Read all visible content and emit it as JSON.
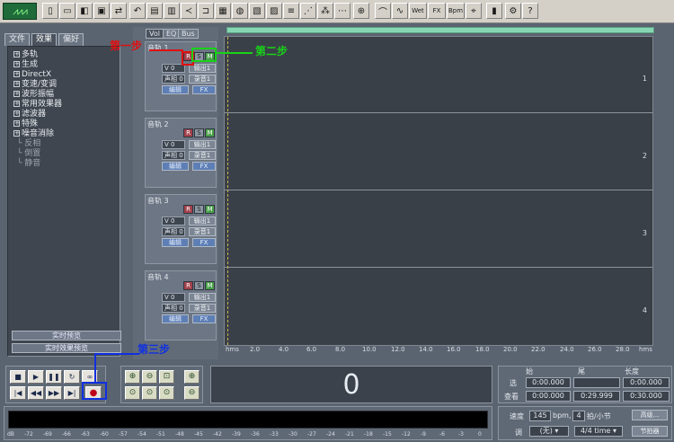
{
  "colors": {
    "step1": "#e01010",
    "step2": "#19d219",
    "step3": "#1030e0"
  },
  "left_panel": {
    "tabs": [
      "文件",
      "效果",
      "偏好"
    ],
    "tree": [
      {
        "label": "多轨",
        "expandable": true
      },
      {
        "label": "生成",
        "expandable": true
      },
      {
        "label": "DirectX",
        "expandable": true
      },
      {
        "label": "变速/变调",
        "expandable": true
      },
      {
        "label": "波形振幅",
        "expandable": true
      },
      {
        "label": "常用效果器",
        "expandable": true
      },
      {
        "label": "滤波器",
        "expandable": true
      },
      {
        "label": "特殊",
        "expandable": true
      },
      {
        "label": "噪音消除",
        "expandable": true
      },
      {
        "label": "反相",
        "expandable": false
      },
      {
        "label": "倒置",
        "expandable": false
      },
      {
        "label": "静音",
        "expandable": false
      }
    ],
    "btn_realtime": "实时预览",
    "btn_effects": "实时效果预览"
  },
  "track_tabs": [
    "Vol",
    "EQ",
    "Bus"
  ],
  "tracks": [
    {
      "name": "音轨 1",
      "vol": "V 0",
      "pan": "声相 0",
      "out": "输出1",
      "in": "录音1",
      "edit": "编辑",
      "fx": "FX",
      "lane": "1"
    },
    {
      "name": "音轨 2",
      "vol": "V 0",
      "pan": "声相 0",
      "out": "输出1",
      "in": "录音1",
      "edit": "编辑",
      "fx": "FX",
      "lane": "2"
    },
    {
      "name": "音轨 3",
      "vol": "V 0",
      "pan": "声相 0",
      "out": "输出1",
      "in": "录音1",
      "edit": "编辑",
      "fx": "FX",
      "lane": "3"
    },
    {
      "name": "音轨 4",
      "vol": "V 0",
      "pan": "声相 0",
      "out": "输出1",
      "in": "录音1",
      "edit": "编辑",
      "fx": "FX",
      "lane": "4"
    }
  ],
  "rsm": {
    "r": "R",
    "s": "S",
    "m": "M"
  },
  "ruler": [
    "hms",
    "2.0",
    "4.0",
    "6.0",
    "8.0",
    "10.0",
    "12.0",
    "14.0",
    "16.0",
    "18.0",
    "20.0",
    "22.0",
    "24.0",
    "26.0",
    "28.0",
    "hms"
  ],
  "annotations": {
    "step1": "第一步",
    "step2": "第二步",
    "step3": "第三步"
  },
  "counter": "0",
  "time": {
    "head_start": "始",
    "head_end": "尾",
    "head_length": "长度",
    "label_sel": "选",
    "label_view": "查看",
    "sel_start": "0:00.000",
    "sel_end": "",
    "sel_length": "0:00.000",
    "view_start": "0:00.000",
    "view_end": "0:29.999",
    "view_length": "0:30.000"
  },
  "meter_db": [
    "dB",
    "-72",
    "-69",
    "-66",
    "-63",
    "-60",
    "-57",
    "-54",
    "-51",
    "-48",
    "-45",
    "-42",
    "-39",
    "-36",
    "-33",
    "-30",
    "-27",
    "-24",
    "-21",
    "-18",
    "-15",
    "-12",
    "-9",
    "-6",
    "-3",
    "0"
  ],
  "tempo": {
    "label_tempo": "速度",
    "tempo": "145",
    "bpm": "bpm,",
    "beats": "4",
    "beats_label": "拍/小节",
    "advanced": "高级...",
    "label_key": "调",
    "key": "(无)",
    "timesig": "4/4 time",
    "metronome": "节拍器"
  }
}
